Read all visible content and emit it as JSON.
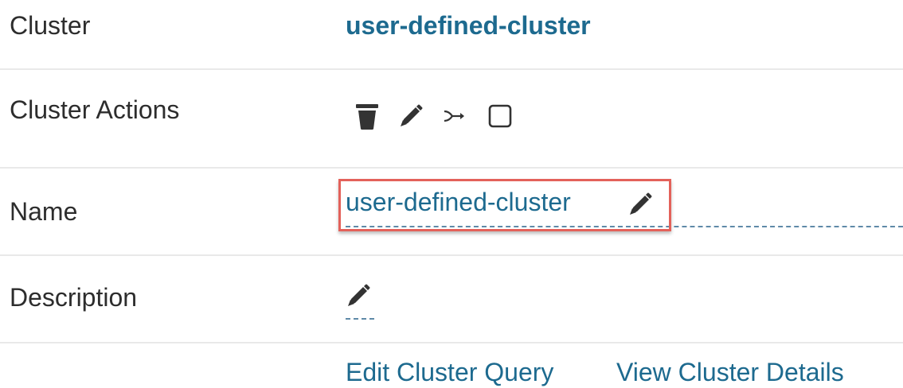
{
  "cluster": {
    "label": "Cluster",
    "value": "user-defined-cluster"
  },
  "cluster_actions": {
    "label": "Cluster Actions",
    "icons": [
      "trash-icon",
      "pencil-icon",
      "merge-arrow-icon",
      "checkbox-icon"
    ]
  },
  "name": {
    "label": "Name",
    "value": "user-defined-cluster",
    "edit_icon": "pencil-icon"
  },
  "description": {
    "label": "Description",
    "value": "",
    "edit_icon": "pencil-icon"
  },
  "links": {
    "edit_query": "Edit Cluster Query",
    "view_details": "View Cluster Details"
  },
  "colors": {
    "link": "#1d6a8f",
    "icon": "#333333",
    "highlight": "#e3615a",
    "divider": "#e9e9e9"
  }
}
